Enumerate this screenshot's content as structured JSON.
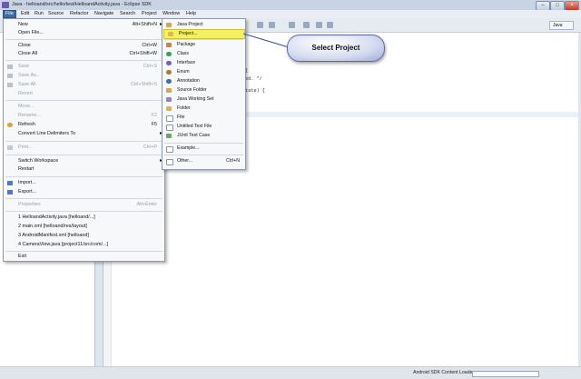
{
  "window": {
    "title": "Java - helloand/src/hello/test/HelloandActivity.java - Eclipse SDK",
    "controls": {
      "minimize": "–",
      "maximize": "□",
      "close": "×"
    }
  },
  "menubar": [
    "File",
    "Edit",
    "Run",
    "Source",
    "Refactor",
    "Navigate",
    "Search",
    "Project",
    "Window",
    "Help"
  ],
  "toolbar": {
    "perspective": "Java"
  },
  "editor": {
    "code_lines": [
      "{",
      "ed. */",
      "State) {"
    ]
  },
  "file_menu": {
    "items": [
      {
        "label": "New",
        "shortcut": "Alt+Shift+N",
        "submenu": true
      },
      {
        "label": "Open File..."
      },
      {
        "label": "Close",
        "shortcut": "Ctrl+W"
      },
      {
        "label": "Close All",
        "shortcut": "Ctrl+Shift+W"
      },
      {
        "label": "Save",
        "shortcut": "Ctrl+S",
        "disabled": true
      },
      {
        "label": "Save As...",
        "disabled": true
      },
      {
        "label": "Save All",
        "shortcut": "Ctrl+Shift+S",
        "disabled": true
      },
      {
        "label": "Revert",
        "disabled": true
      },
      {
        "label": "Move...",
        "disabled": true
      },
      {
        "label": "Rename...",
        "shortcut": "F2",
        "disabled": true
      },
      {
        "label": "Refresh",
        "shortcut": "F5"
      },
      {
        "label": "Convert Line Delimiters To",
        "submenu": true
      },
      {
        "label": "Print...",
        "shortcut": "Ctrl+P",
        "disabled": true
      },
      {
        "label": "Switch Workspace",
        "submenu": true
      },
      {
        "label": "Restart"
      },
      {
        "label": "Import..."
      },
      {
        "label": "Export..."
      },
      {
        "label": "Properties",
        "shortcut": "Alt+Enter",
        "disabled": true
      },
      {
        "label": "1 HelloandActivity.java  [helloand/...]"
      },
      {
        "label": "2 main.xml  [helloand/res/layout]"
      },
      {
        "label": "3 AndroidManifest.xml  [helloand]"
      },
      {
        "label": "4 CameraView.java  [project11/src/com/...]"
      },
      {
        "label": "Exit"
      }
    ]
  },
  "new_submenu": {
    "items": [
      {
        "label": "Java Project",
        "icon": "java-project-icon"
      },
      {
        "label": "Project...",
        "icon": "project-icon",
        "highlighted": true
      },
      {
        "label": "Package",
        "icon": "package-icon"
      },
      {
        "label": "Class",
        "icon": "class-icon"
      },
      {
        "label": "Interface",
        "icon": "interface-icon"
      },
      {
        "label": "Enum",
        "icon": "enum-icon"
      },
      {
        "label": "Annotation",
        "icon": "annotation-icon"
      },
      {
        "label": "Source Folder",
        "icon": "source-folder-icon"
      },
      {
        "label": "Java Working Set",
        "icon": "working-set-icon"
      },
      {
        "label": "Folder",
        "icon": "folder-icon"
      },
      {
        "label": "File",
        "icon": "file-icon"
      },
      {
        "label": "Untitled Text File",
        "icon": "text-file-icon"
      },
      {
        "label": "JUnit Test Case",
        "icon": "junit-icon"
      },
      {
        "label": "Example...",
        "icon": "example-icon"
      },
      {
        "label": "Other...",
        "shortcut": "Ctrl+N",
        "icon": "other-icon"
      }
    ]
  },
  "callout": {
    "text": "Select Project"
  },
  "statusbar": {
    "text": "Android SDK Content Loader"
  },
  "colors": {
    "highlight": "#f4f060",
    "menu_active": "#3b6ea8",
    "callout_border": "#5a67a8"
  }
}
